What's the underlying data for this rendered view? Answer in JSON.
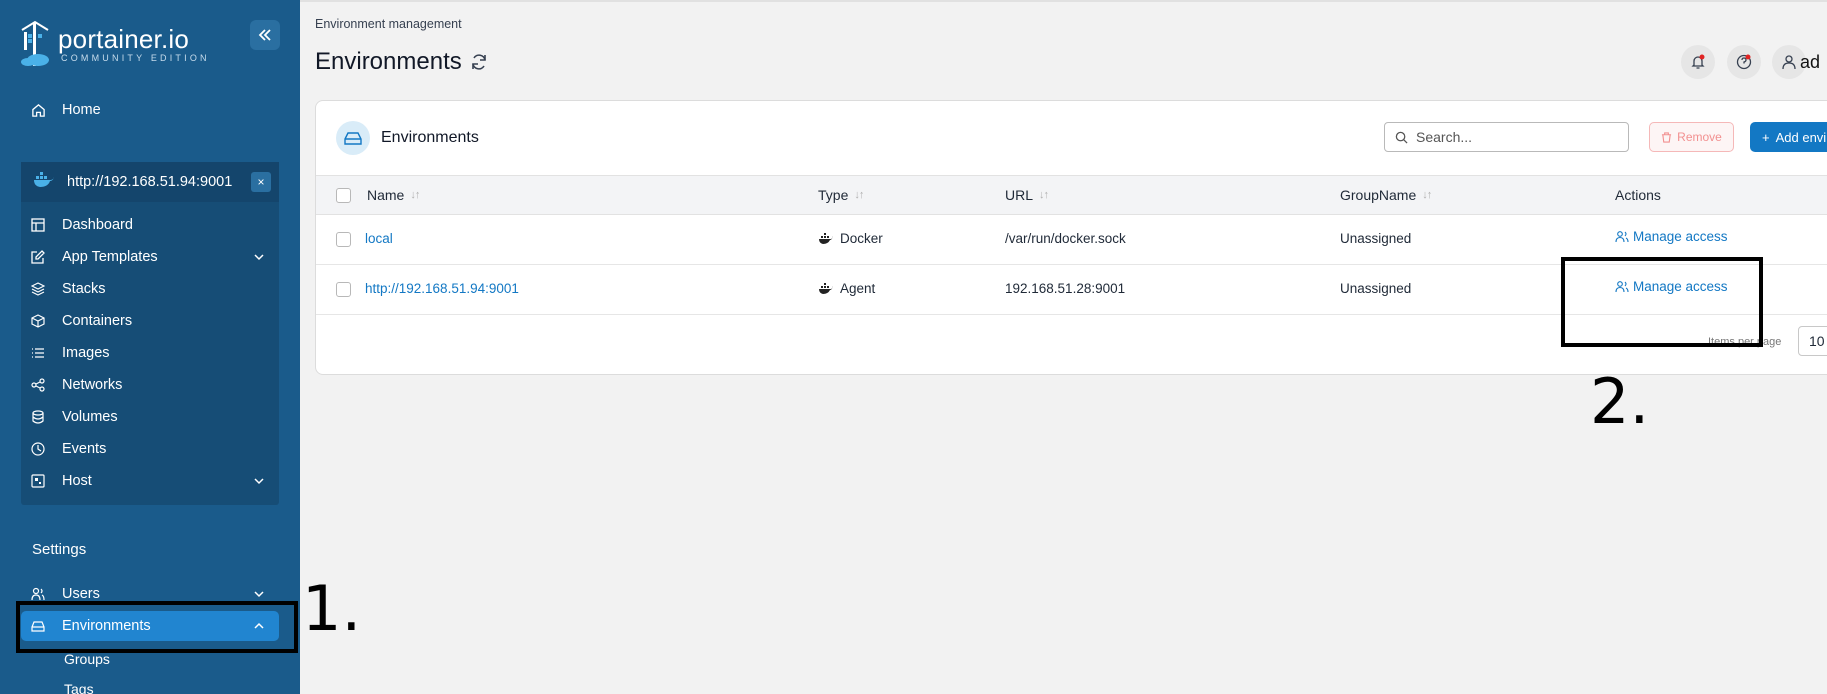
{
  "app": {
    "logo_name": "portainer.io",
    "logo_sub": "COMMUNITY EDITION"
  },
  "sidebar": {
    "home": "Home",
    "environment_url": "http://192.168.51.94:9001",
    "env_close": "×",
    "items": [
      {
        "label": "Dashboard",
        "icon": "dashboard-icon"
      },
      {
        "label": "App Templates",
        "icon": "edit-icon"
      },
      {
        "label": "Stacks",
        "icon": "layers-icon"
      },
      {
        "label": "Containers",
        "icon": "box-icon"
      },
      {
        "label": "Images",
        "icon": "list-icon"
      },
      {
        "label": "Networks",
        "icon": "share-icon"
      },
      {
        "label": "Volumes",
        "icon": "database-icon"
      },
      {
        "label": "Events",
        "icon": "clock-icon"
      },
      {
        "label": "Host",
        "icon": "cpu-icon"
      }
    ],
    "settings_title": "Settings",
    "users": "Users",
    "environments": "Environments",
    "groups": "Groups",
    "tags": "Tags"
  },
  "annotations": {
    "one": "1.",
    "two": "2."
  },
  "header": {
    "breadcrumb": "Environment management",
    "title": "Environments",
    "user_initials": "ad"
  },
  "card": {
    "title": "Environments",
    "search_placeholder": "Search...",
    "remove_label": "Remove",
    "add_label": "Add envi",
    "columns": [
      "Name",
      "Type",
      "URL",
      "GroupName",
      "Actions"
    ],
    "rows": [
      {
        "name": "local",
        "type": "Docker",
        "url": "/var/run/docker.sock",
        "group": "Unassigned",
        "action": "Manage access"
      },
      {
        "name": "http://192.168.51.94:9001",
        "type": "Agent",
        "url": "192.168.51.28:9001",
        "group": "Unassigned",
        "action": "Manage access"
      }
    ],
    "items_per_page_label": "Items per page",
    "items_per_page_value": "10"
  },
  "colors": {
    "sidebar_bg": "#1a5b8b",
    "active_item": "#2185d0",
    "accent": "#1378c4"
  }
}
